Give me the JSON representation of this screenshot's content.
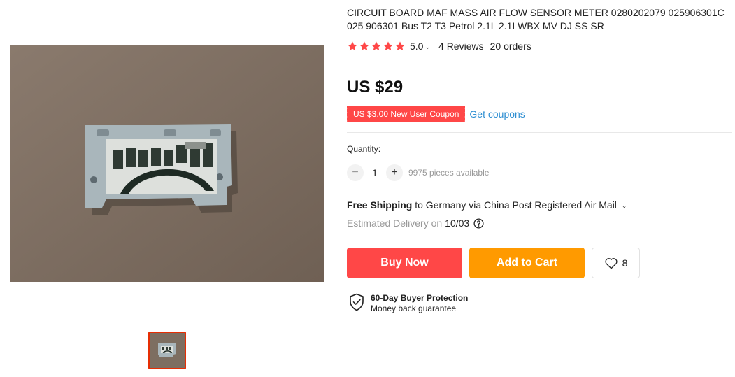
{
  "product": {
    "title": "CIRCUIT BOARD MAF MASS AIR FLOW SENSOR METER 0280202079 025906301C 025 906301 Bus T2 T3 Petrol 2.1L 2.1I WBX MV DJ SS SR",
    "rating_value": "5.0",
    "rating_stars": 5,
    "reviews": "4 Reviews",
    "orders": "20 orders",
    "price": "US $29",
    "coupon_label": "US $3.00 New User Coupon",
    "get_coupons_label": "Get coupons"
  },
  "quantity": {
    "label": "Quantity:",
    "minus": "−",
    "plus": "+",
    "value": "1",
    "available": "9975 pieces available"
  },
  "shipping": {
    "free_label": "Free Shipping",
    "details": "to Germany via China Post Registered Air Mail",
    "delivery_prefix": "Estimated Delivery on",
    "delivery_date": "10/03"
  },
  "actions": {
    "buy_now": "Buy Now",
    "add_to_cart": "Add to Cart",
    "wishlist_count": "8"
  },
  "protection": {
    "title": "60-Day Buyer Protection",
    "subtitle": "Money back guarantee"
  },
  "colors": {
    "accent_red": "#ff4747",
    "accent_orange": "#ff9a00",
    "link_blue": "#2f8fd2",
    "thumb_border": "#e62e04"
  },
  "icons": [
    "star-icon",
    "chevron-down-icon",
    "question-icon",
    "heart-icon",
    "shield-check-icon"
  ]
}
